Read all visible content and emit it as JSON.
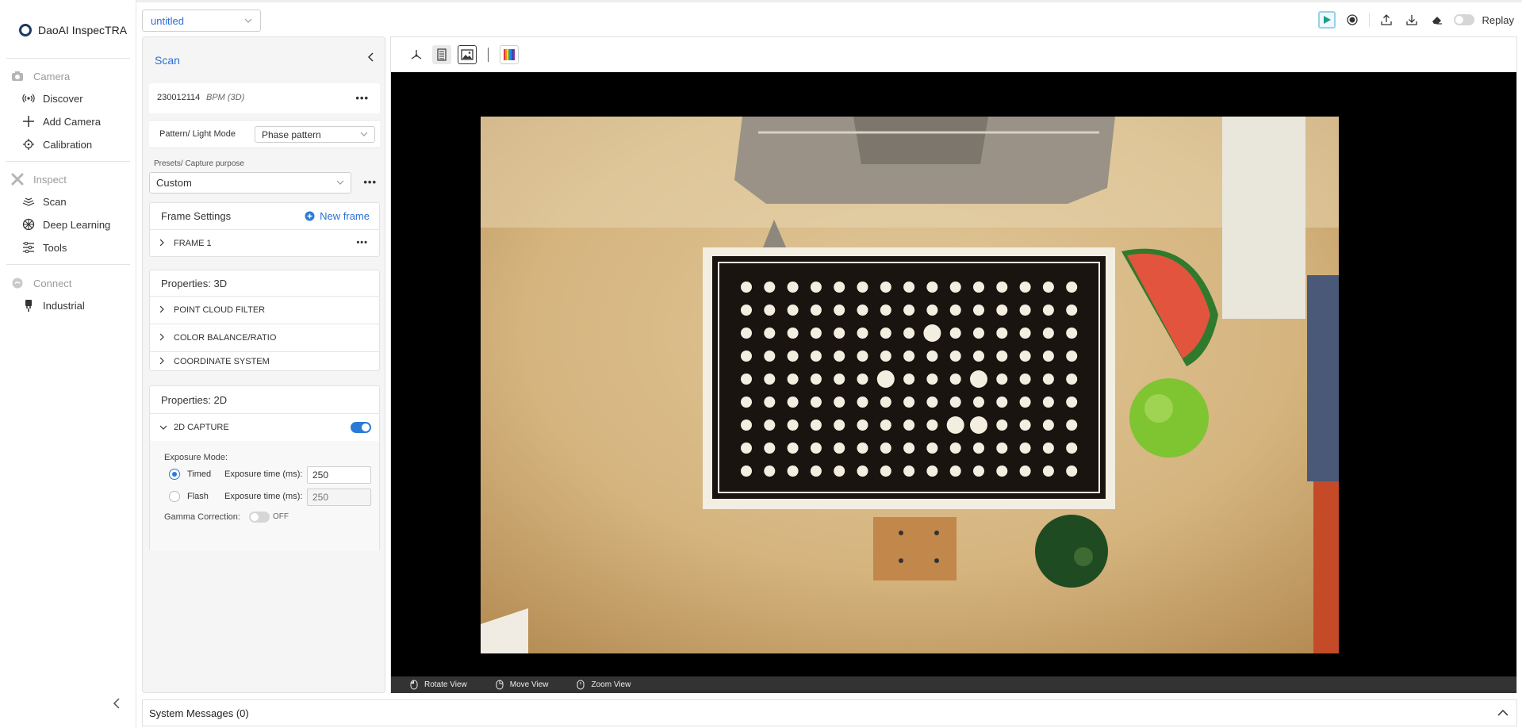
{
  "app": {
    "name": "DaoAI InspecTRA"
  },
  "nav": {
    "sections": [
      {
        "label": "Camera",
        "items": [
          "Discover",
          "Add Camera",
          "Calibration"
        ]
      },
      {
        "label": "Inspect",
        "items": [
          "Scan",
          "Deep Learning",
          "Tools"
        ]
      },
      {
        "label": "Connect",
        "items": [
          "Industrial"
        ]
      }
    ]
  },
  "topbar": {
    "project": "untitled",
    "replay_label": "Replay",
    "replay_on": false
  },
  "panel": {
    "title": "Scan",
    "device": {
      "serial": "230012114",
      "model": "BPM (3D)"
    },
    "pattern": {
      "label": "Pattern/ Light Mode",
      "value": "Phase pattern"
    },
    "presets": {
      "label": "Presets/ Capture purpose",
      "value": "Custom"
    },
    "frame_settings": {
      "title": "Frame Settings",
      "new_frame": "New frame",
      "frames": [
        "FRAME 1"
      ]
    },
    "props3d": {
      "title": "Properties: 3D",
      "rows": [
        "POINT CLOUD FILTER",
        "COLOR BALANCE/RATIO",
        "COORDINATE SYSTEM"
      ]
    },
    "props2d": {
      "title": "Properties: 2D",
      "capture_label": "2D CAPTURE",
      "capture_on": true,
      "exposure_mode_label": "Exposure Mode:",
      "timed_label": "Timed",
      "flash_label": "Flash",
      "exposure_time_label": "Exposure time (ms):",
      "timed_value": "250",
      "flash_value": "250",
      "selected_mode": "Timed",
      "gamma_label": "Gamma Correction:",
      "gamma_state": "OFF"
    }
  },
  "viewer": {
    "footer": {
      "rotate": "Rotate View",
      "move": "Move View",
      "zoom": "Zoom View"
    }
  },
  "system_messages": {
    "label": "System Messages (0)"
  },
  "colors": {
    "accent": "#2b6fd6",
    "toggle_on": "#2b7bd6",
    "play": "#17a08c"
  }
}
